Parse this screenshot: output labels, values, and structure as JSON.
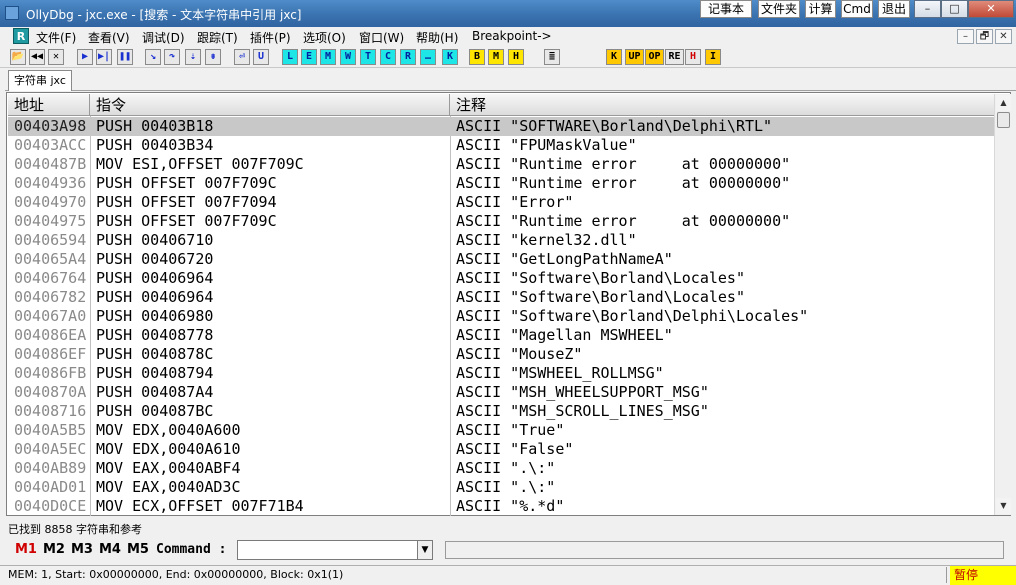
{
  "window": {
    "title": "OllyDbg - jxc.exe - [搜索 - 文本字符串中引用 jxc]",
    "quick_buttons": [
      "记事本",
      "文件夹",
      "计算",
      "Cmd",
      "退出"
    ],
    "controls": {
      "minimize": "–",
      "maximize": "□",
      "close": "✕"
    }
  },
  "menu": {
    "icon_label": "R",
    "items": [
      "文件(F)",
      "查看(V)",
      "调试(D)",
      "跟踪(T)",
      "插件(P)",
      "选项(O)",
      "窗口(W)",
      "帮助(H)",
      "Breakpoint->"
    ],
    "mdi": {
      "minimize": "–",
      "restore": "🗗",
      "close": "✕"
    }
  },
  "toolbar": {
    "buttons": [
      {
        "name": "open",
        "glyph": "📂",
        "style": "gray"
      },
      {
        "name": "restart",
        "glyph": "◀◀",
        "style": "gray"
      },
      {
        "name": "close",
        "glyph": "✕",
        "style": "gray"
      },
      {
        "name": "run",
        "glyph": "▶",
        "style": "blue"
      },
      {
        "name": "run-thread",
        "glyph": "▶|",
        "style": "blue"
      },
      {
        "name": "pause",
        "glyph": "❚❚",
        "style": "blue"
      },
      {
        "name": "step-into",
        "glyph": "↘",
        "style": "blue"
      },
      {
        "name": "step-over",
        "glyph": "↷",
        "style": "blue"
      },
      {
        "name": "trace-into",
        "glyph": "⇣",
        "style": "blue"
      },
      {
        "name": "trace-over",
        "glyph": "⇟",
        "style": "blue"
      },
      {
        "name": "execute-till-return",
        "glyph": "⏎",
        "style": "blue"
      },
      {
        "name": "execute-till-user",
        "glyph": "U",
        "style": "blue"
      },
      {
        "name": "log",
        "glyph": "L",
        "style": "cyan"
      },
      {
        "name": "modules",
        "glyph": "E",
        "style": "cyan"
      },
      {
        "name": "memory",
        "glyph": "M",
        "style": "cyan"
      },
      {
        "name": "windows",
        "glyph": "W",
        "style": "cyan"
      },
      {
        "name": "threads",
        "glyph": "T",
        "style": "cyan"
      },
      {
        "name": "cpu",
        "glyph": "C",
        "style": "cyan"
      },
      {
        "name": "patches",
        "glyph": "R",
        "style": "cyan"
      },
      {
        "name": "call-tree",
        "glyph": "…",
        "style": "cyan"
      },
      {
        "name": "call-stack",
        "glyph": "K",
        "style": "cyan"
      },
      {
        "name": "breakpoints",
        "glyph": "B",
        "style": "yellow"
      },
      {
        "name": "memory-breakpoints",
        "glyph": "M",
        "style": "yellow"
      },
      {
        "name": "hardware-breakpoints",
        "glyph": "H",
        "style": "yellow"
      },
      {
        "name": "options",
        "glyph": "≣",
        "style": "gray"
      },
      {
        "name": "plugin-k",
        "glyph": "K",
        "style": "orange"
      },
      {
        "name": "plugin-up",
        "glyph": "UP",
        "style": "orange"
      },
      {
        "name": "plugin-op",
        "glyph": "OP",
        "style": "orange"
      },
      {
        "name": "plugin-re",
        "glyph": "RE",
        "style": "gray"
      },
      {
        "name": "plugin-h",
        "glyph": "H",
        "style": "red"
      },
      {
        "name": "plugin-i",
        "glyph": "I",
        "style": "orange"
      }
    ]
  },
  "tab": {
    "label": "字符串 jxc"
  },
  "table": {
    "columns": [
      "地址",
      "指令",
      "注释"
    ],
    "rows": [
      {
        "addr": "00403A98",
        "ins": "PUSH 00403B18",
        "cmt": "ASCII \"SOFTWARE\\Borland\\Delphi\\RTL\"",
        "selected": true
      },
      {
        "addr": "00403ACC",
        "ins": "PUSH 00403B34",
        "cmt": "ASCII \"FPUMaskValue\""
      },
      {
        "addr": "0040487B",
        "ins": "MOV ESI,OFFSET 007F709C",
        "cmt": "ASCII \"Runtime error     at 00000000\""
      },
      {
        "addr": "00404936",
        "ins": "PUSH OFFSET 007F709C",
        "cmt": "ASCII \"Runtime error     at 00000000\""
      },
      {
        "addr": "00404970",
        "ins": "PUSH OFFSET 007F7094",
        "cmt": "ASCII \"Error\""
      },
      {
        "addr": "00404975",
        "ins": "PUSH OFFSET 007F709C",
        "cmt": "ASCII \"Runtime error     at 00000000\""
      },
      {
        "addr": "00406594",
        "ins": "PUSH 00406710",
        "cmt": "ASCII \"kernel32.dll\""
      },
      {
        "addr": "004065A4",
        "ins": "PUSH 00406720",
        "cmt": "ASCII \"GetLongPathNameA\""
      },
      {
        "addr": "00406764",
        "ins": "PUSH 00406964",
        "cmt": "ASCII \"Software\\Borland\\Locales\""
      },
      {
        "addr": "00406782",
        "ins": "PUSH 00406964",
        "cmt": "ASCII \"Software\\Borland\\Locales\""
      },
      {
        "addr": "004067A0",
        "ins": "PUSH 00406980",
        "cmt": "ASCII \"Software\\Borland\\Delphi\\Locales\""
      },
      {
        "addr": "004086EA",
        "ins": "PUSH 00408778",
        "cmt": "ASCII \"Magellan MSWHEEL\""
      },
      {
        "addr": "004086EF",
        "ins": "PUSH 0040878C",
        "cmt": "ASCII \"MouseZ\""
      },
      {
        "addr": "004086FB",
        "ins": "PUSH 00408794",
        "cmt": "ASCII \"MSWHEEL_ROLLMSG\""
      },
      {
        "addr": "0040870A",
        "ins": "PUSH 004087A4",
        "cmt": "ASCII \"MSH_WHEELSUPPORT_MSG\""
      },
      {
        "addr": "00408716",
        "ins": "PUSH 004087BC",
        "cmt": "ASCII \"MSH_SCROLL_LINES_MSG\""
      },
      {
        "addr": "0040A5B5",
        "ins": "MOV EDX,0040A600",
        "cmt": "ASCII \"True\""
      },
      {
        "addr": "0040A5EC",
        "ins": "MOV EDX,0040A610",
        "cmt": "ASCII \"False\""
      },
      {
        "addr": "0040AB89",
        "ins": "MOV EAX,0040ABF4",
        "cmt": "ASCII \".\\:\""
      },
      {
        "addr": "0040AD01",
        "ins": "MOV EAX,0040AD3C",
        "cmt": "ASCII \".\\:\""
      },
      {
        "addr": "0040D0CE",
        "ins": "MOV ECX,OFFSET 007F71B4",
        "cmt": "ASCII \"%.*d\""
      }
    ]
  },
  "scrollbar": {
    "up": "▲",
    "down": "▼"
  },
  "found_status": "已找到 8858 字符串和参考",
  "command_bar": {
    "m_buttons": [
      "M1",
      "M2",
      "M3",
      "M4",
      "M5"
    ],
    "label": "Command :",
    "value": "",
    "dropdown_arrow": "▼"
  },
  "status_bar": {
    "text": "MEM: 1, Start: 0x00000000, End: 0x00000000, Block: 0x1(1)",
    "state": "暂停"
  },
  "colors": {
    "title_bar": "#3a73b0",
    "selected_row": "#c8c8c8",
    "paused_bg": "#ffff00",
    "paused_text": "#c00000",
    "m1_color": "#d00000"
  }
}
